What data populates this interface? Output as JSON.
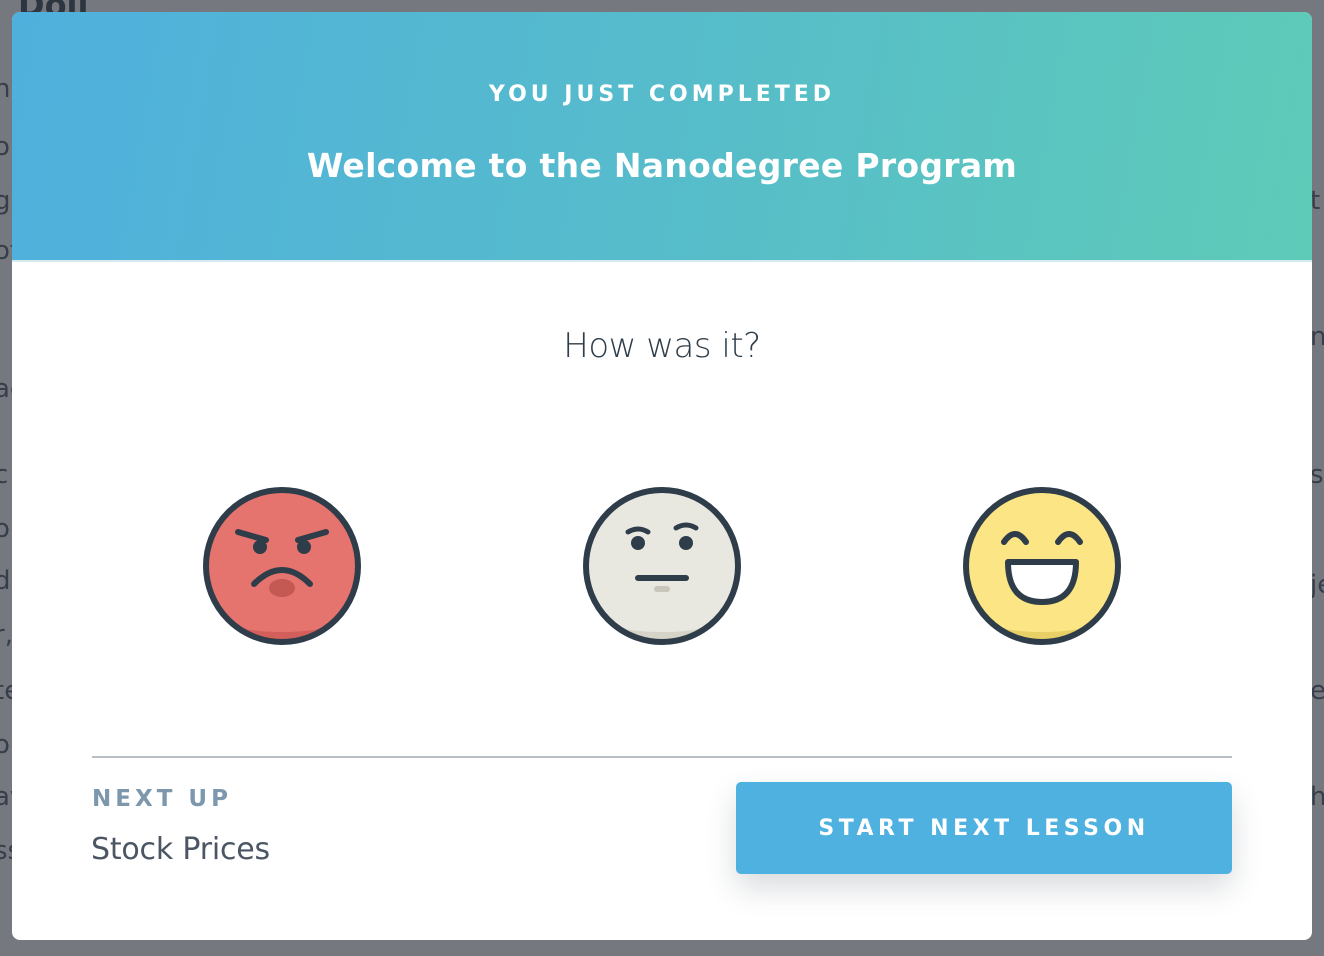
{
  "modal": {
    "eyebrow": "YOU JUST COMPLETED",
    "lesson_title": "Welcome to the Nanodegree Program",
    "question": "How was it?",
    "ratings": [
      {
        "icon": "angry-face-icon",
        "color": "#e5736e"
      },
      {
        "icon": "neutral-face-icon",
        "color": "#e9e8e0"
      },
      {
        "icon": "happy-face-icon",
        "color": "#fbe584"
      }
    ],
    "next": {
      "label": "NEXT UP",
      "title": "Stock Prices"
    },
    "start_button": "START NEXT LESSON"
  },
  "colors": {
    "header_gradient_start": "#4fb0dd",
    "header_gradient_end": "#5ecbb8",
    "button": "#4fb1e0",
    "outline": "#2e3d49"
  }
}
